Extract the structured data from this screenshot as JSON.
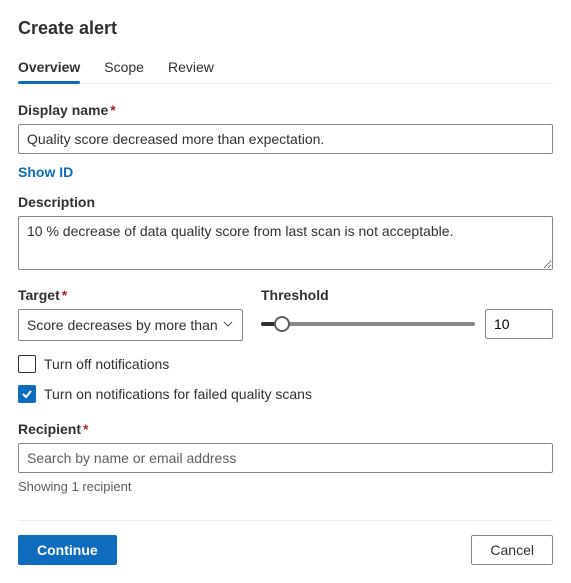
{
  "header": {
    "title": "Create alert"
  },
  "tabs": {
    "overview": "Overview",
    "scope": "Scope",
    "review": "Review"
  },
  "displayName": {
    "label": "Display name",
    "value": "Quality score decreased more than expectation."
  },
  "showId": "Show ID",
  "description": {
    "label": "Description",
    "value": "10 % decrease of data quality score from last scan is not acceptable."
  },
  "target": {
    "label": "Target",
    "selected": "Score decreases by more than"
  },
  "threshold": {
    "label": "Threshold",
    "value": "10"
  },
  "notifications": {
    "turnOff": "Turn off notifications",
    "turnOnFailed": "Turn on notifications for failed quality scans"
  },
  "recipient": {
    "label": "Recipient",
    "placeholder": "Search by name or email address",
    "showing": "Showing 1 recipient"
  },
  "footer": {
    "continue": "Continue",
    "cancel": "Cancel"
  }
}
